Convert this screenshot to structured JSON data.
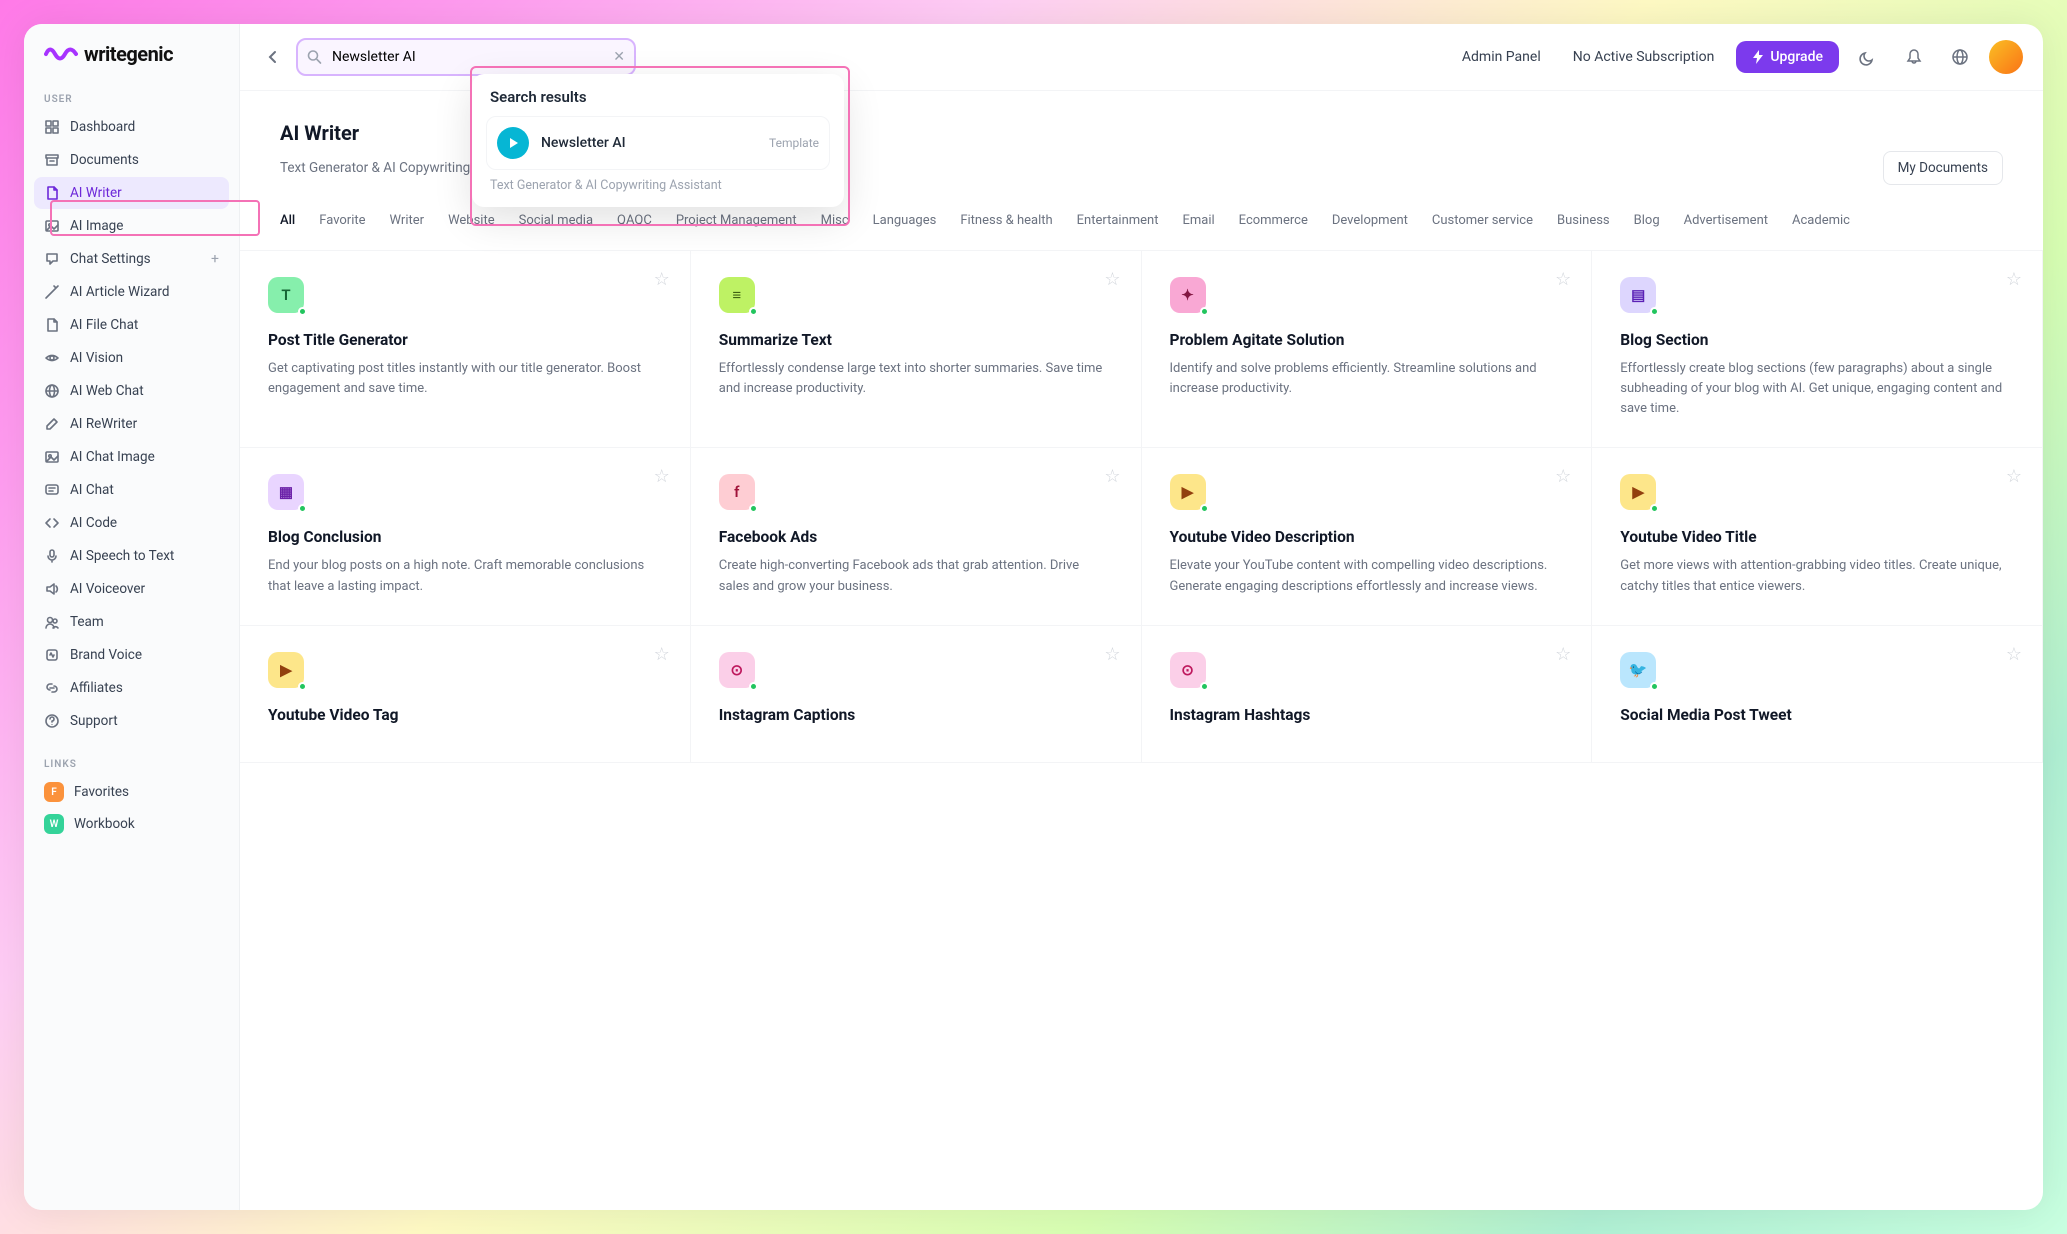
{
  "brand": "writegenic",
  "sidebar": {
    "section_user": "USER",
    "section_links": "LINKS",
    "items": [
      {
        "label": "Dashboard",
        "icon": "grid"
      },
      {
        "label": "Documents",
        "icon": "archive"
      },
      {
        "label": "AI Writer",
        "icon": "file",
        "active": true
      },
      {
        "label": "AI Image",
        "icon": "image"
      },
      {
        "label": "Chat Settings",
        "icon": "chat",
        "plus": true
      },
      {
        "label": "AI Article Wizard",
        "icon": "wand"
      },
      {
        "label": "AI File Chat",
        "icon": "file"
      },
      {
        "label": "AI Vision",
        "icon": "eye"
      },
      {
        "label": "AI Web Chat",
        "icon": "globe"
      },
      {
        "label": "AI ReWriter",
        "icon": "edit"
      },
      {
        "label": "AI Chat Image",
        "icon": "image"
      },
      {
        "label": "AI Chat",
        "icon": "message"
      },
      {
        "label": "AI Code",
        "icon": "code"
      },
      {
        "label": "AI Speech to Text",
        "icon": "mic"
      },
      {
        "label": "AI Voiceover",
        "icon": "volume"
      },
      {
        "label": "Team",
        "icon": "users"
      },
      {
        "label": "Brand Voice",
        "icon": "voice"
      },
      {
        "label": "Affiliates",
        "icon": "link"
      },
      {
        "label": "Support",
        "icon": "help"
      }
    ],
    "links": [
      {
        "label": "Favorites",
        "badge": "F",
        "color": "f"
      },
      {
        "label": "Workbook",
        "badge": "W",
        "color": "w"
      }
    ]
  },
  "topbar": {
    "search_value": "Newsletter AI",
    "admin": "Admin Panel",
    "subscription": "No Active Subscription",
    "upgrade": "Upgrade"
  },
  "search_results": {
    "heading": "Search results",
    "items": [
      {
        "title": "Newsletter AI",
        "tag": "Template"
      }
    ],
    "subtitle": "Text Generator & AI Copywriting Assistant"
  },
  "page": {
    "title": "AI Writer",
    "desc": "Text Generator & AI Copywriting Assistant",
    "my_docs": "My Documents"
  },
  "filters": [
    "All",
    "Favorite",
    "Writer",
    "Website",
    "Social media",
    "QAQC",
    "Project Management",
    "Misc",
    "Languages",
    "Fitness & health",
    "Entertainment",
    "Email",
    "Ecommerce",
    "Development",
    "Customer service",
    "Business",
    "Blog",
    "Advertisement",
    "Academic"
  ],
  "cards": [
    {
      "title": "Post Title Generator",
      "desc": "Get captivating post titles instantly with our title generator. Boost engagement and save time.",
      "icon": "T",
      "bg": "#86efac",
      "fg": "#166534"
    },
    {
      "title": "Summarize Text",
      "desc": "Effortlessly condense large text into shorter summaries. Save time and increase productivity.",
      "icon": "≡",
      "bg": "#bef264",
      "fg": "#3f6212"
    },
    {
      "title": "Problem Agitate Solution",
      "desc": "Identify and solve problems efficiently. Streamline solutions and increase productivity.",
      "icon": "✦",
      "bg": "#f9a8d4",
      "fg": "#831843"
    },
    {
      "title": "Blog Section",
      "desc": "Effortlessly create blog sections (few paragraphs) about a single subheading of your blog with AI. Get unique, engaging content and save time.",
      "icon": "▤",
      "bg": "#ddd6fe",
      "fg": "#5b21b6"
    },
    {
      "title": "Blog Conclusion",
      "desc": "End your blog posts on a high note. Craft memorable conclusions that leave a lasting impact.",
      "icon": "▦",
      "bg": "#e9d5ff",
      "fg": "#6b21a8"
    },
    {
      "title": "Facebook Ads",
      "desc": "Create high-converting Facebook ads that grab attention. Drive sales and grow your business.",
      "icon": "f",
      "bg": "#fecdd3",
      "fg": "#9f1239"
    },
    {
      "title": "Youtube Video Description",
      "desc": "Elevate your YouTube content with compelling video descriptions. Generate engaging descriptions effortlessly and increase views.",
      "icon": "▶",
      "bg": "#fde68a",
      "fg": "#92400e"
    },
    {
      "title": "Youtube Video Title",
      "desc": "Get more views with attention-grabbing video titles. Create unique, catchy titles that entice viewers.",
      "icon": "▶",
      "bg": "#fde68a",
      "fg": "#92400e"
    },
    {
      "title": "Youtube Video Tag",
      "desc": "",
      "icon": "▶",
      "bg": "#fde68a",
      "fg": "#92400e"
    },
    {
      "title": "Instagram Captions",
      "desc": "",
      "icon": "⊙",
      "bg": "#fbcfe8",
      "fg": "#be185d"
    },
    {
      "title": "Instagram Hashtags",
      "desc": "",
      "icon": "⊙",
      "bg": "#fbcfe8",
      "fg": "#be185d"
    },
    {
      "title": "Social Media Post Tweet",
      "desc": "",
      "icon": "🐦",
      "bg": "#bae6fd",
      "fg": "#075985"
    }
  ]
}
